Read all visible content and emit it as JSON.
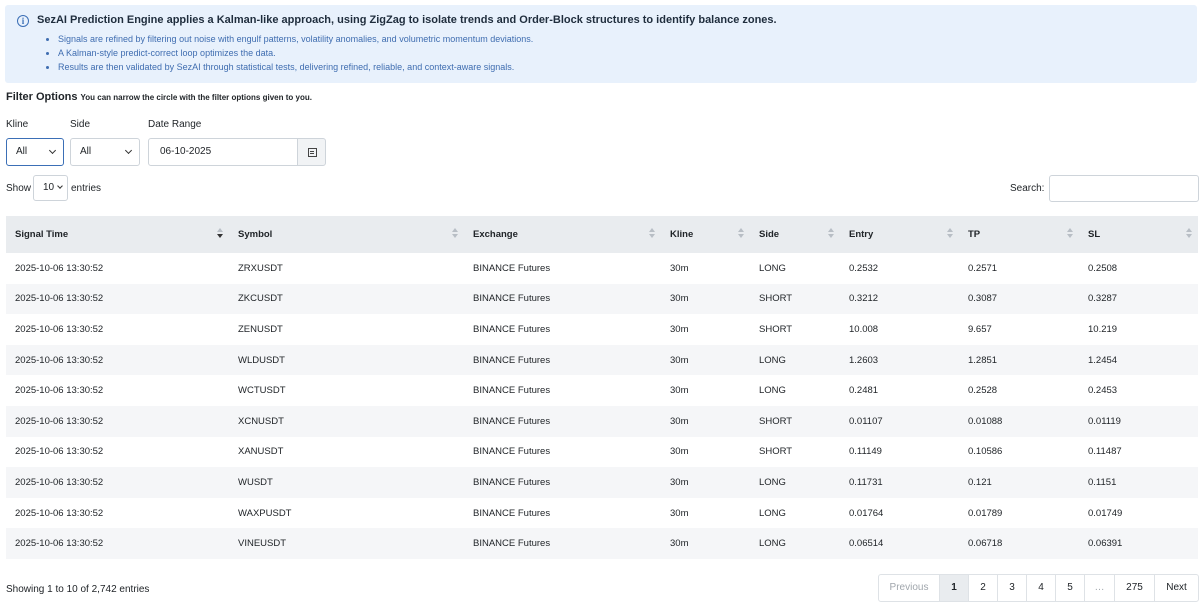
{
  "info": {
    "title": "SezAI Prediction Engine applies a Kalman-like approach, using ZigZag to isolate trends and Order-Block structures to identify balance zones.",
    "bullets": [
      "Signals are refined by filtering out noise with engulf patterns, volatility anomalies, and volumetric momentum deviations.",
      "A Kalman-style predict-correct loop optimizes the data.",
      "Results are then validated by SezAI through statistical tests, delivering refined, reliable, and context-aware signals."
    ]
  },
  "filters": {
    "title": "Filter Options",
    "subtitle": "You can narrow the circle with the filter options given to you.",
    "kline_label": "Kline",
    "kline_value": "All",
    "side_label": "Side",
    "side_value": "All",
    "date_label": "Date Range",
    "date_value": "06-10-2025"
  },
  "length": {
    "show": "Show",
    "value": "10",
    "entries": "entries"
  },
  "search": {
    "label": "Search:",
    "value": ""
  },
  "columns": [
    "Signal Time",
    "Symbol",
    "Exchange",
    "Kline",
    "Side",
    "Entry",
    "TP",
    "SL"
  ],
  "rows": [
    [
      "2025-10-06 13:30:52",
      "ZRXUSDT",
      "BINANCE Futures",
      "30m",
      "LONG",
      "0.2532",
      "0.2571",
      "0.2508"
    ],
    [
      "2025-10-06 13:30:52",
      "ZKCUSDT",
      "BINANCE Futures",
      "30m",
      "SHORT",
      "0.3212",
      "0.3087",
      "0.3287"
    ],
    [
      "2025-10-06 13:30:52",
      "ZENUSDT",
      "BINANCE Futures",
      "30m",
      "SHORT",
      "10.008",
      "9.657",
      "10.219"
    ],
    [
      "2025-10-06 13:30:52",
      "WLDUSDT",
      "BINANCE Futures",
      "30m",
      "LONG",
      "1.2603",
      "1.2851",
      "1.2454"
    ],
    [
      "2025-10-06 13:30:52",
      "WCTUSDT",
      "BINANCE Futures",
      "30m",
      "LONG",
      "0.2481",
      "0.2528",
      "0.2453"
    ],
    [
      "2025-10-06 13:30:52",
      "XCNUSDT",
      "BINANCE Futures",
      "30m",
      "SHORT",
      "0.01107",
      "0.01088",
      "0.01119"
    ],
    [
      "2025-10-06 13:30:52",
      "XANUSDT",
      "BINANCE Futures",
      "30m",
      "SHORT",
      "0.11149",
      "0.10586",
      "0.11487"
    ],
    [
      "2025-10-06 13:30:52",
      "WUSDT",
      "BINANCE Futures",
      "30m",
      "LONG",
      "0.11731",
      "0.121",
      "0.1151"
    ],
    [
      "2025-10-06 13:30:52",
      "WAXPUSDT",
      "BINANCE Futures",
      "30m",
      "LONG",
      "0.01764",
      "0.01789",
      "0.01749"
    ],
    [
      "2025-10-06 13:30:52",
      "VINEUSDT",
      "BINANCE Futures",
      "30m",
      "LONG",
      "0.06514",
      "0.06718",
      "0.06391"
    ]
  ],
  "footer": {
    "info": "Showing 1 to 10 of 2,742 entries",
    "pages": [
      "Previous",
      "1",
      "2",
      "3",
      "4",
      "5",
      "…",
      "275",
      "Next"
    ]
  }
}
